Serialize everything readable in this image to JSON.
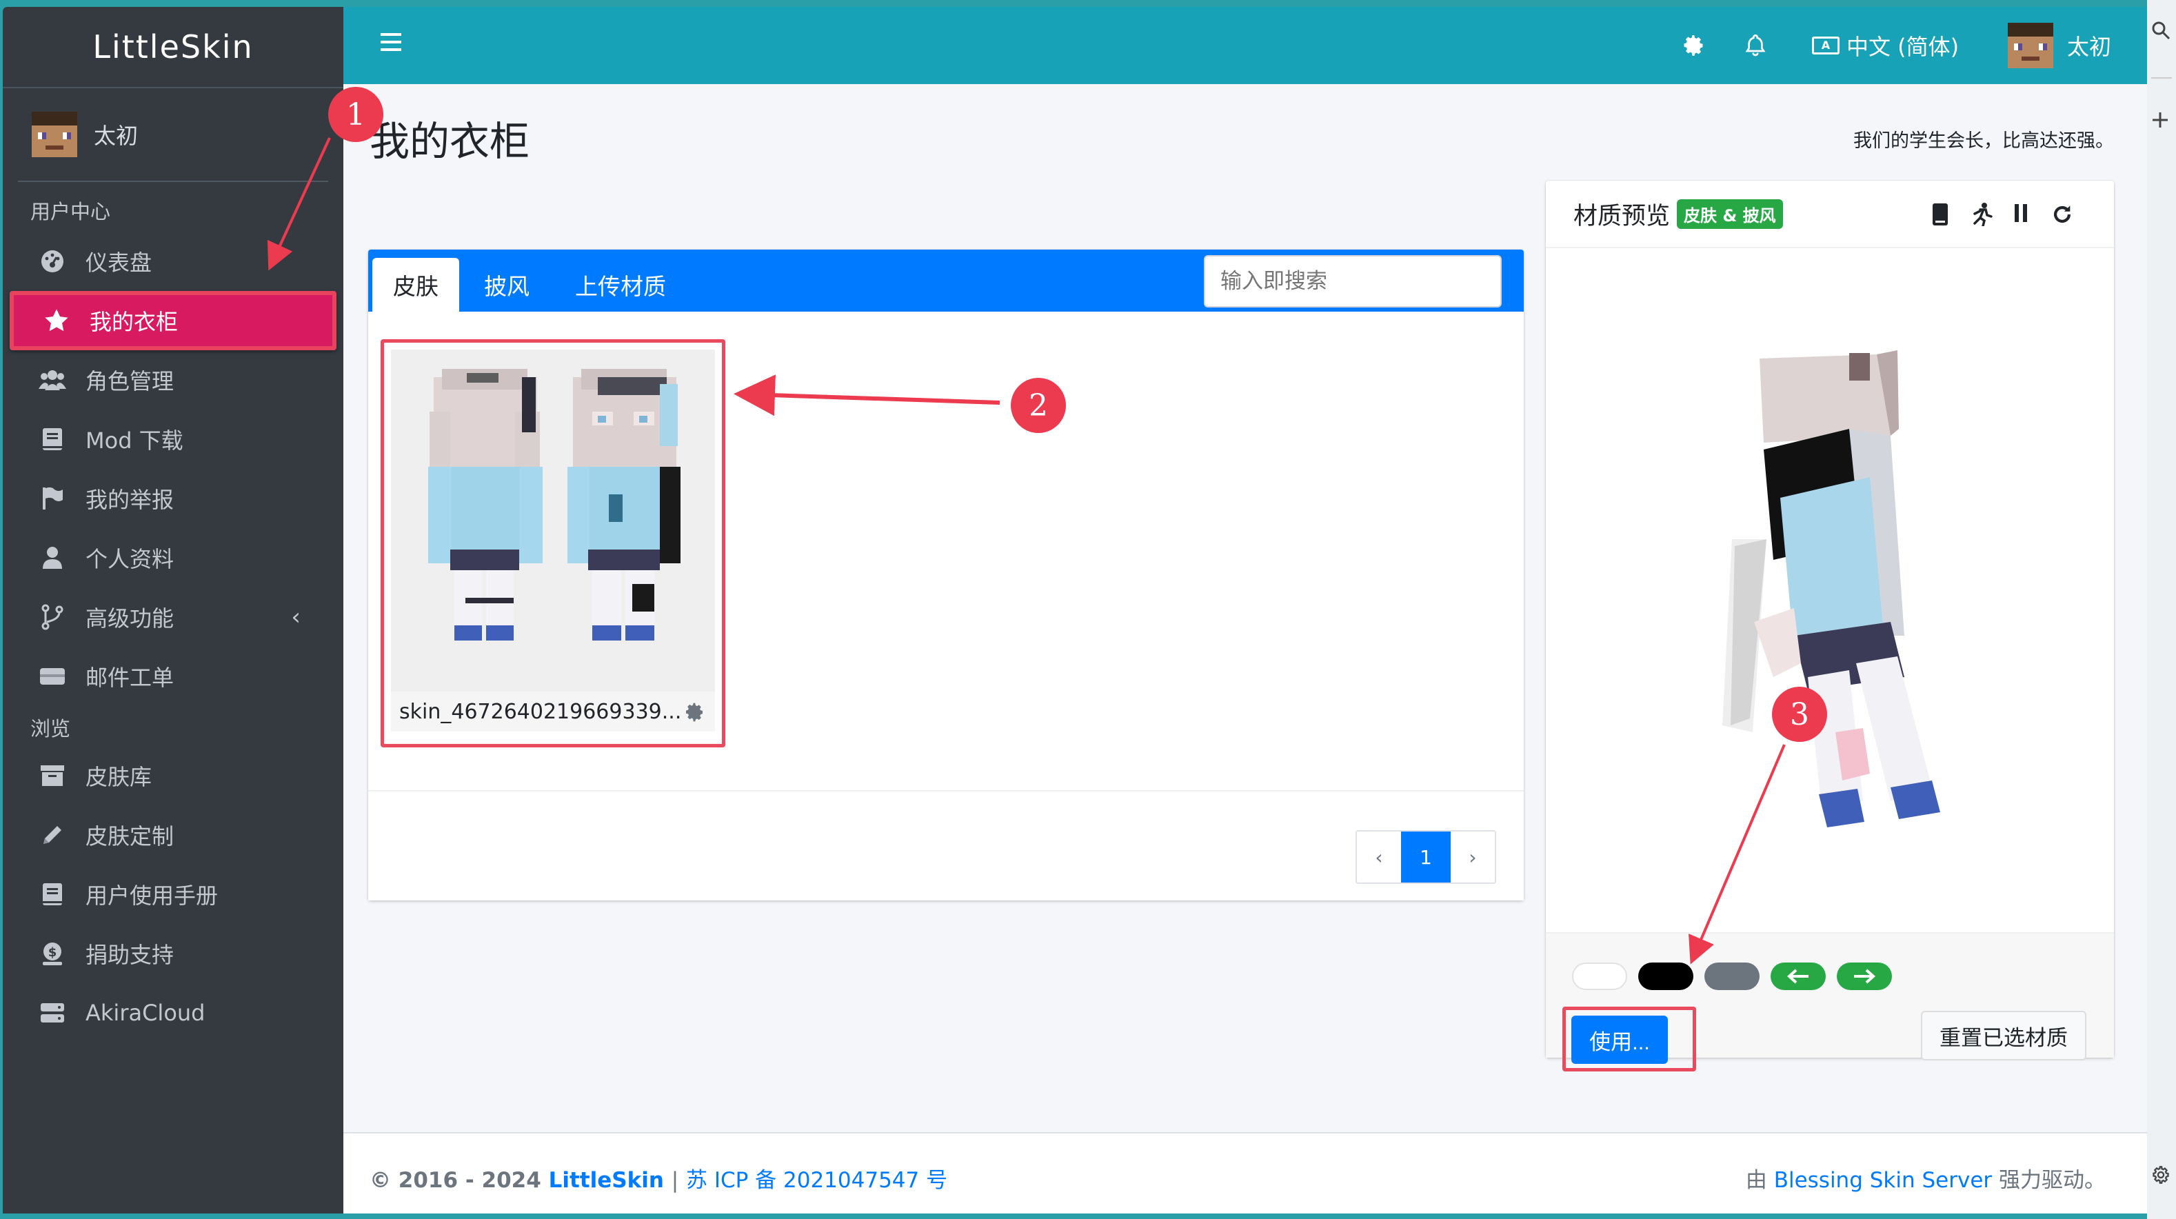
{
  "brand": "LittleSkin",
  "user": {
    "name": "太初"
  },
  "sidebar": {
    "sections": [
      {
        "header": "用户中心"
      },
      {
        "header": "浏览"
      }
    ],
    "items": [
      {
        "label": "仪表盘",
        "icon": "dashboard-icon"
      },
      {
        "label": "我的衣柜",
        "icon": "star-icon",
        "active": true
      },
      {
        "label": "角色管理",
        "icon": "users-icon"
      },
      {
        "label": "Mod 下载",
        "icon": "book-icon"
      },
      {
        "label": "我的举报",
        "icon": "flag-icon"
      },
      {
        "label": "个人资料",
        "icon": "user-icon"
      },
      {
        "label": "高级功能",
        "icon": "branch-icon"
      },
      {
        "label": "邮件工单",
        "icon": "ticket-icon"
      },
      {
        "label": "皮肤库",
        "icon": "archive-icon"
      },
      {
        "label": "皮肤定制",
        "icon": "pencil-icon"
      },
      {
        "label": "用户使用手册",
        "icon": "manual-icon"
      },
      {
        "label": "捐助支持",
        "icon": "donate-icon"
      },
      {
        "label": "AkiraCloud",
        "icon": "server-icon"
      }
    ],
    "chevron": "‹"
  },
  "topbar": {
    "language": "中文 (简体)",
    "user_name": "太初"
  },
  "page": {
    "title": "我的衣柜",
    "motto": "我们的学生会长，比高达还强。"
  },
  "closet": {
    "tabs": [
      "皮肤",
      "披风",
      "上传材质"
    ],
    "search_placeholder": "输入即搜索",
    "item": {
      "name": "skin_4672640219669339..."
    },
    "pagination": {
      "prev": "‹",
      "current": "1",
      "next": "›"
    }
  },
  "preview": {
    "title": "材质预览",
    "badge": "皮肤 & 披风",
    "use_button": "使用...",
    "reset_button": "重置已选材质",
    "swatch_colors": [
      "#ffffff",
      "#000000",
      "#6c757d"
    ],
    "arrow_color": "#28a745"
  },
  "footer": {
    "years": "© 2016 - 2024",
    "brand": "LittleSkin",
    "separator": "|",
    "icp": "苏 ICP 备 2021047547 号",
    "powered_prefix": "由",
    "powered_link": "Blessing Skin Server",
    "powered_suffix": "强力驱动。"
  },
  "annotations": {
    "markers": [
      "1",
      "2",
      "3"
    ],
    "color": "#ec3a4f"
  },
  "colors": {
    "topbar": "#17a2b8",
    "sidebar": "#343a40",
    "active_item": "#d81b60",
    "primary": "#007bff"
  }
}
